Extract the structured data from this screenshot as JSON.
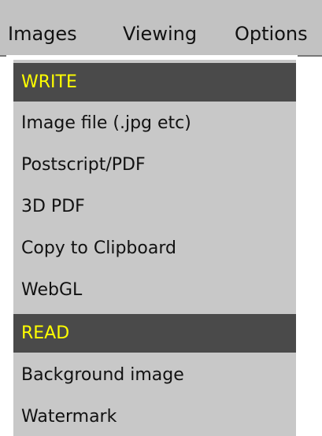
{
  "menubar": {
    "items": [
      {
        "label": "Images"
      },
      {
        "label": "Viewing"
      },
      {
        "label": "Options"
      }
    ]
  },
  "dropdown": {
    "write_header": "WRITE",
    "write_items": [
      "Image file (.jpg etc)",
      "Postscript/PDF",
      "3D PDF",
      "Copy to Clipboard",
      "WebGL"
    ],
    "read_header": "READ",
    "read_items": [
      "Background image",
      "Watermark"
    ]
  },
  "colors": {
    "menubar_bg": "#c2c2c2",
    "dropdown_bg": "#c8c8c8",
    "section_header_bg": "#4a4a4a",
    "section_header_text": "#ffff00",
    "item_text": "#111111"
  }
}
